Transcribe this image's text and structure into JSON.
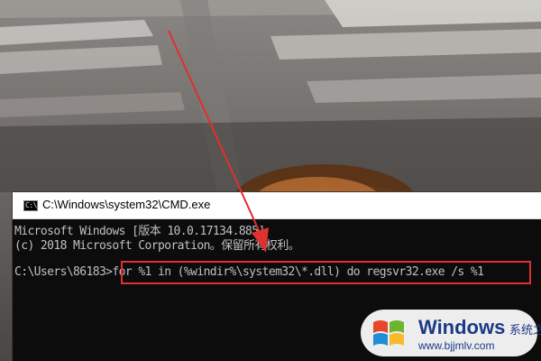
{
  "window": {
    "title": "C:\\Windows\\system32\\CMD.exe",
    "icon": "cmd-icon",
    "icon_text": "C:\\"
  },
  "console": {
    "lines": [
      "Microsoft Windows [版本 10.0.17134.885]",
      "(c) 2018 Microsoft Corporation。保留所有权利。",
      "",
      "C:\\Users\\86183>"
    ],
    "prompt": "C:\\Users\\86183>",
    "command": "for %1 in (%windir%\\system32\\*.dll) do regsvr32.exe /s %1"
  },
  "annotation": {
    "highlight_color": "#e03030",
    "arrow_color": "#e03030"
  },
  "watermark": {
    "brand": "Windows",
    "brand_cn": "系统之家",
    "url": "www.bjjmlv.com",
    "logo": "windows-logo-icon"
  },
  "colors": {
    "console_bg": "#0c0c0c",
    "console_text": "#c0c0c0",
    "titlebar_bg": "#ffffff",
    "brand_blue": "#1a3a86"
  }
}
